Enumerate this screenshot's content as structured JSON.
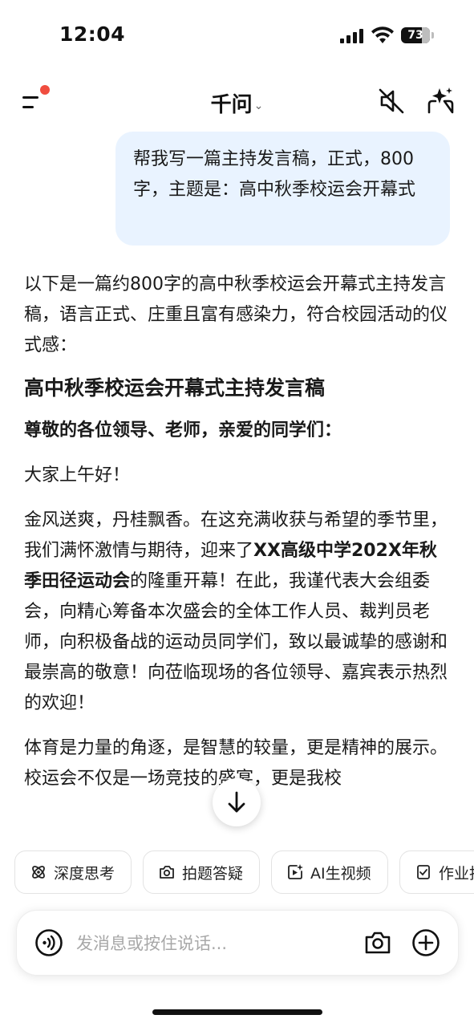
{
  "status_bar": {
    "time": "12:04",
    "battery": "73",
    "battery_level": 0.73
  },
  "nav": {
    "title": "千问",
    "title_caret": "⌄"
  },
  "user_message": {
    "text": "帮我写一篇主持发言稿，正式，800字，主题是：高中秋季校运会开幕式"
  },
  "answer": {
    "intro": "以下是一篇约800字的高中秋季校运会开幕式主持发言稿，语言正式、庄重且富有感染力，符合校园活动的仪式感：",
    "heading": "高中秋季校运会开幕式主持发言稿",
    "salutation": "尊敬的各位领导、老师，亲爱的同学们：",
    "greeting": "大家上午好！",
    "p1_a": "金风送爽，丹桂飘香。在这充满收获与希望的季节里，我们满怀激情与期待，迎来了",
    "p1_bold": "XX高级中学202X年秋季田径运动会",
    "p1_b": "的隆重开幕！在此，我谨代表大会组委会，向精心筹备本次盛会的全体工作人员、裁判员老师，向积极备战的运动员同学们，致以最诚挚的感谢和最崇高的敬意！向莅临现场的各位领导、嘉宾表示热烈的欢迎！",
    "p2": "体育是力量的角逐，是智慧的较量，更是精神的展示。校运会不仅是一场竞技的盛宴，更是我校"
  },
  "chips": [
    {
      "label": "深度思考",
      "icon": "atom-icon"
    },
    {
      "label": "拍题答疑",
      "icon": "camera-scan-icon"
    },
    {
      "label": "AI生视频",
      "icon": "video-spark-icon"
    },
    {
      "label": "作业批改",
      "icon": "homework-icon"
    }
  ],
  "input": {
    "placeholder": "发消息或按住说话..."
  },
  "colors": {
    "accent_bubble": "#e9f3ff",
    "badge_red": "#f04d3f",
    "text": "#1a1a1a"
  }
}
